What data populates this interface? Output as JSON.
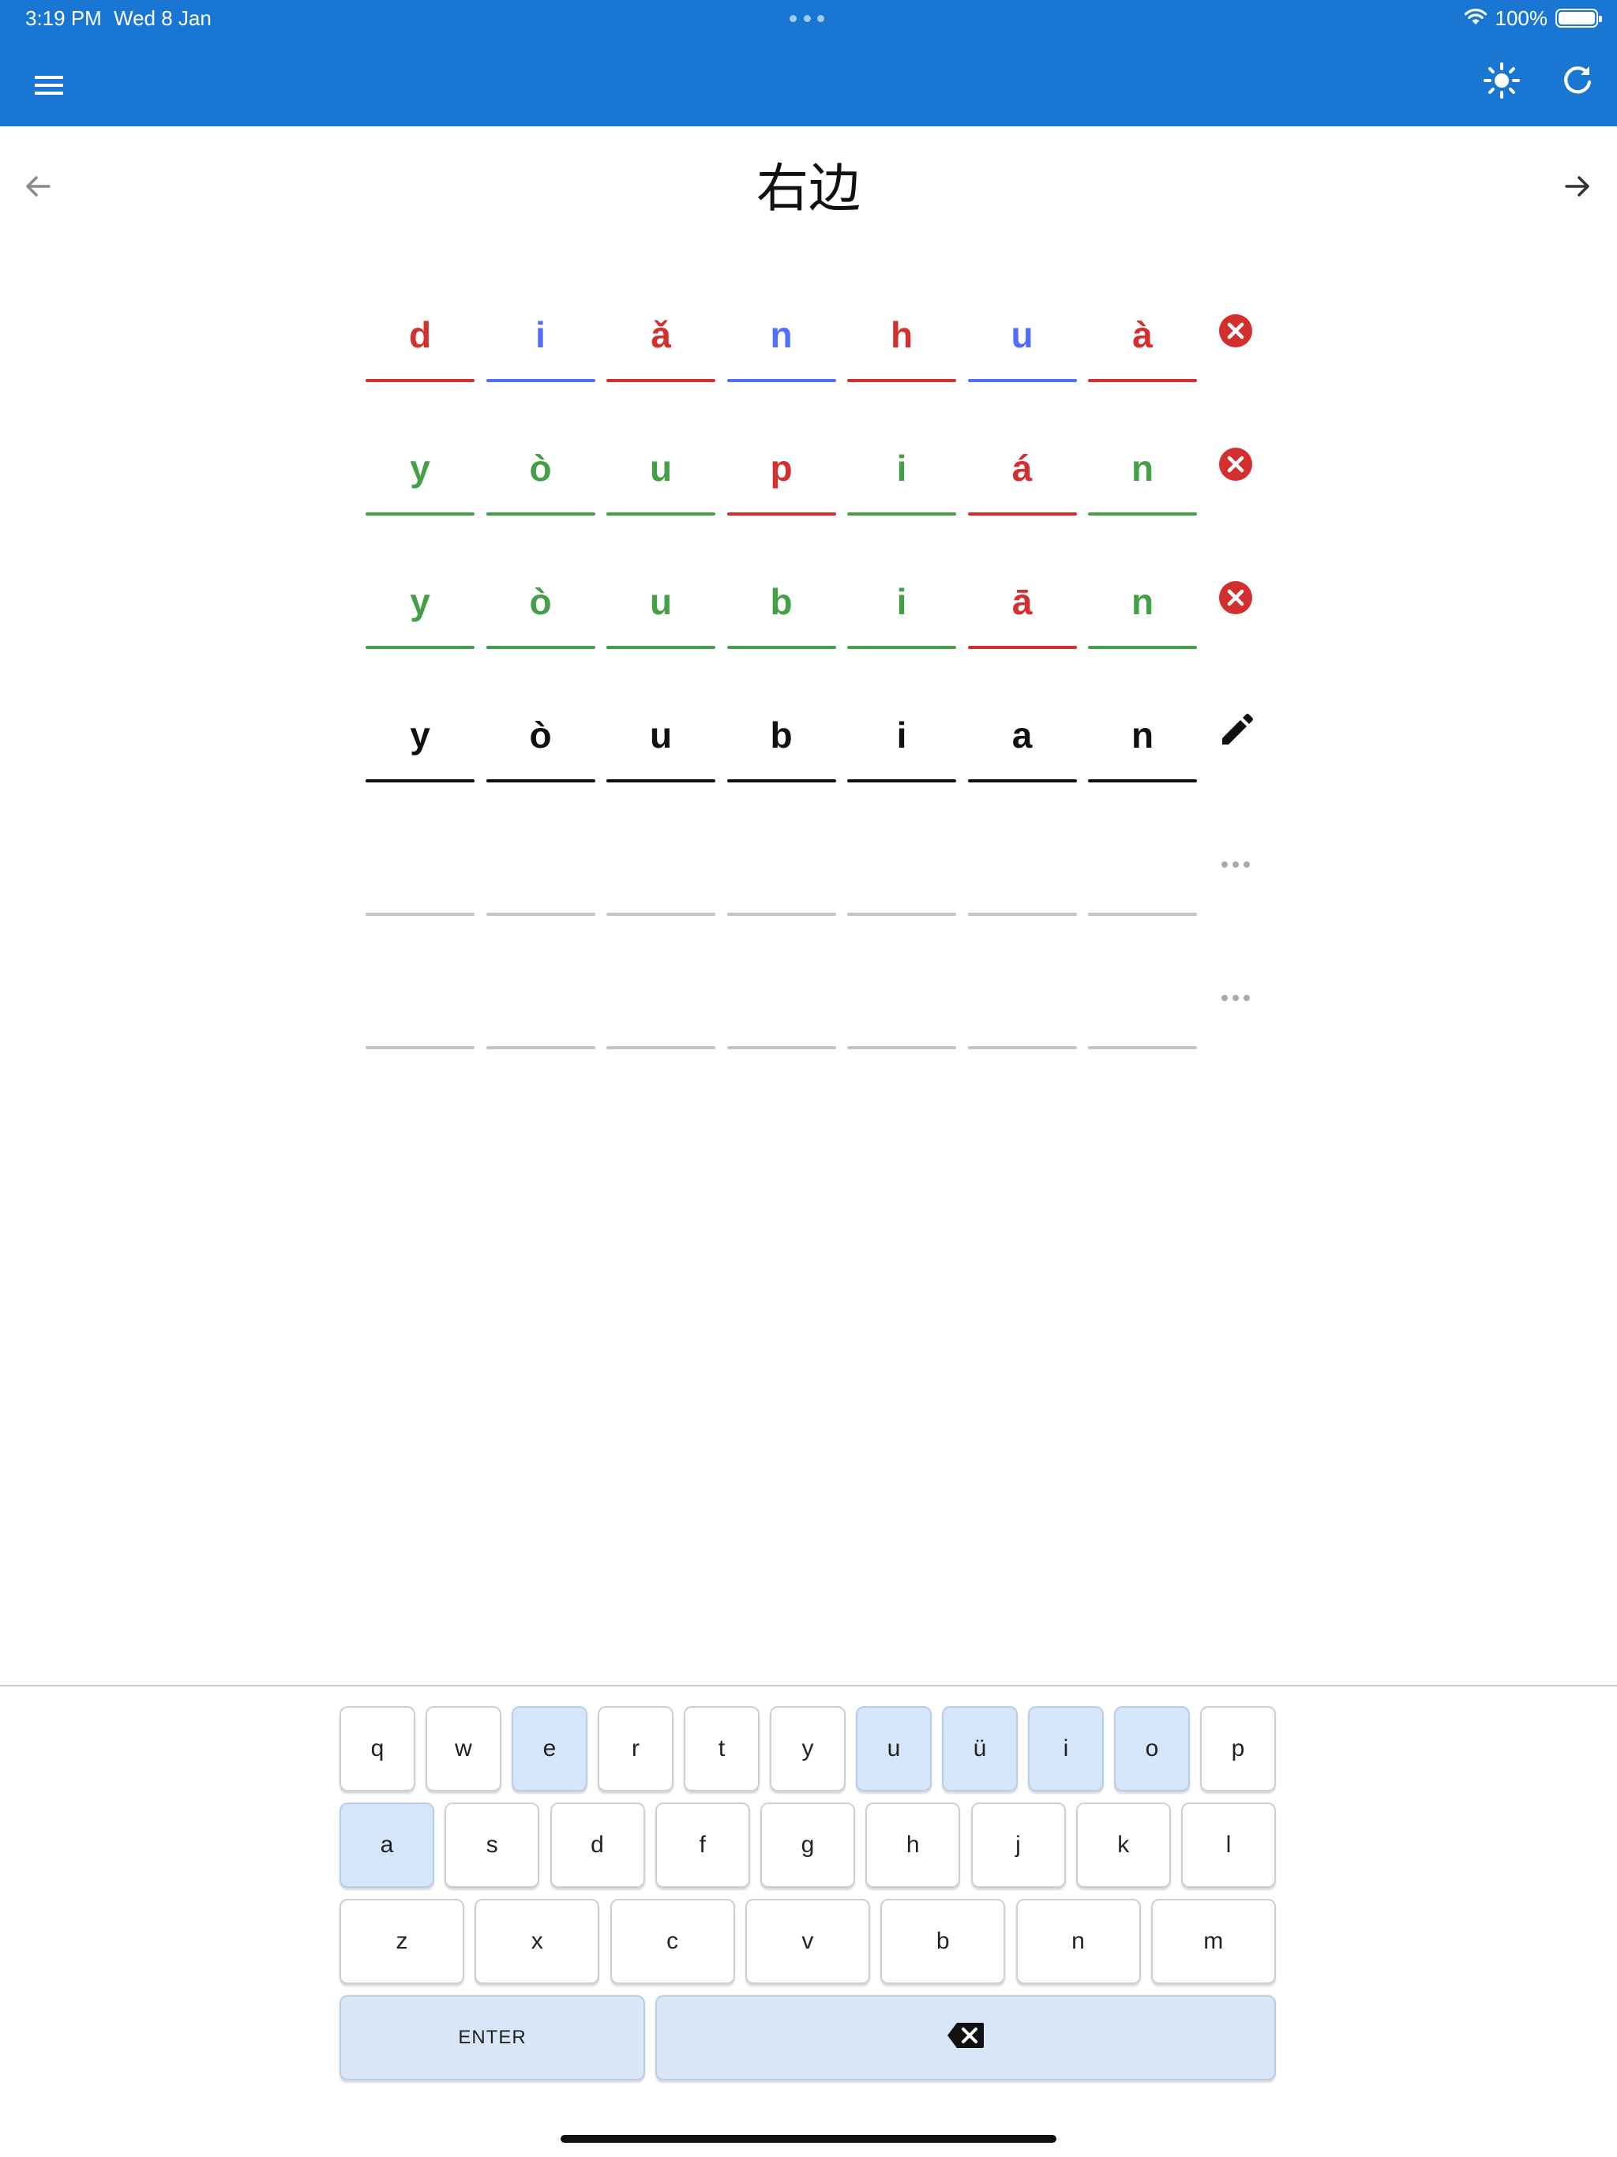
{
  "status_bar": {
    "time": "3:19 PM",
    "date": "Wed 8 Jan",
    "battery_percent": "100%",
    "battery_level": 1.0
  },
  "app_bar": {
    "color": "#1976d2",
    "icons": [
      "menu-icon",
      "brightness-icon",
      "refresh-icon"
    ]
  },
  "word": {
    "characters": "右边"
  },
  "colors": {
    "correct": "#43a047",
    "wrong": "#d32f2f",
    "blue": "#536dfe",
    "active": "#111111",
    "empty": "#c4c4c4",
    "key_highlight": "#d5e6fb"
  },
  "guesses": [
    {
      "status": "incorrect",
      "icon": "cancel-icon",
      "letters": [
        {
          "ch": "d",
          "state": "wrong"
        },
        {
          "ch": "i",
          "state": "blue"
        },
        {
          "ch": "ǎ",
          "state": "wrong"
        },
        {
          "ch": "n",
          "state": "blue"
        },
        {
          "ch": "h",
          "state": "wrong"
        },
        {
          "ch": "u",
          "state": "blue"
        },
        {
          "ch": "à",
          "state": "wrong"
        }
      ]
    },
    {
      "status": "incorrect",
      "icon": "cancel-icon",
      "letters": [
        {
          "ch": "y",
          "state": "correct"
        },
        {
          "ch": "ò",
          "state": "correct"
        },
        {
          "ch": "u",
          "state": "correct"
        },
        {
          "ch": "p",
          "state": "wrong"
        },
        {
          "ch": "i",
          "state": "correct"
        },
        {
          "ch": "á",
          "state": "wrong"
        },
        {
          "ch": "n",
          "state": "correct"
        }
      ]
    },
    {
      "status": "incorrect",
      "icon": "cancel-icon",
      "letters": [
        {
          "ch": "y",
          "state": "correct"
        },
        {
          "ch": "ò",
          "state": "correct"
        },
        {
          "ch": "u",
          "state": "correct"
        },
        {
          "ch": "b",
          "state": "correct"
        },
        {
          "ch": "i",
          "state": "correct"
        },
        {
          "ch": "ā",
          "state": "wrong"
        },
        {
          "ch": "n",
          "state": "correct"
        }
      ]
    },
    {
      "status": "editing",
      "icon": "edit-icon",
      "letters": [
        {
          "ch": "y",
          "state": "active"
        },
        {
          "ch": "ò",
          "state": "active"
        },
        {
          "ch": "u",
          "state": "active"
        },
        {
          "ch": "b",
          "state": "active"
        },
        {
          "ch": "i",
          "state": "active"
        },
        {
          "ch": "a",
          "state": "active"
        },
        {
          "ch": "n",
          "state": "active"
        }
      ]
    },
    {
      "status": "pending",
      "icon": "more-horiz-icon",
      "letters": [
        {
          "ch": "",
          "state": "empty"
        },
        {
          "ch": "",
          "state": "empty"
        },
        {
          "ch": "",
          "state": "empty"
        },
        {
          "ch": "",
          "state": "empty"
        },
        {
          "ch": "",
          "state": "empty"
        },
        {
          "ch": "",
          "state": "empty"
        },
        {
          "ch": "",
          "state": "empty"
        }
      ]
    },
    {
      "status": "pending",
      "icon": "more-horiz-icon",
      "letters": [
        {
          "ch": "",
          "state": "empty"
        },
        {
          "ch": "",
          "state": "empty"
        },
        {
          "ch": "",
          "state": "empty"
        },
        {
          "ch": "",
          "state": "empty"
        },
        {
          "ch": "",
          "state": "empty"
        },
        {
          "ch": "",
          "state": "empty"
        },
        {
          "ch": "",
          "state": "empty"
        }
      ]
    }
  ],
  "keyboard": {
    "rows": [
      [
        "q",
        "w",
        "e",
        "r",
        "t",
        "y",
        "u",
        "ü",
        "i",
        "o",
        "p"
      ],
      [
        "a",
        "s",
        "d",
        "f",
        "g",
        "h",
        "j",
        "k",
        "l"
      ],
      [
        "z",
        "x",
        "c",
        "v",
        "b",
        "n",
        "m"
      ]
    ],
    "highlighted": [
      "e",
      "u",
      "ü",
      "i",
      "o",
      "a"
    ],
    "enter_label": "ENTER",
    "backspace_icon": "backspace-icon"
  }
}
